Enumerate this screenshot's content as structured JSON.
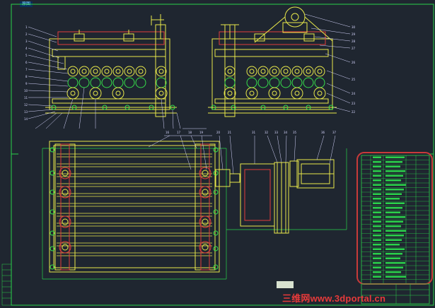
{
  "drawing": {
    "corner_label": "原图",
    "watermark": "三维网www.3dportal.cn",
    "colors": {
      "background": "#1f2630",
      "frame": "#2ad14a",
      "machine": "#e8e84a",
      "roller": "#36e04a",
      "dim": "#d7d7ff",
      "red": "#e23c3c",
      "highlight": "#c83a3a"
    },
    "parts_table_rows": 28
  }
}
